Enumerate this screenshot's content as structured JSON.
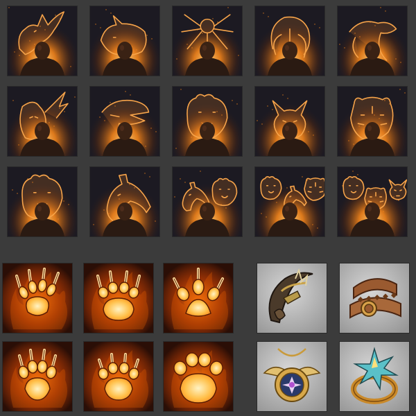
{
  "colors": {
    "background": "#3b3b3b",
    "spirit_bg": "#1c1a22",
    "glow": "#ff8a1a",
    "glow_light": "#ffd07a",
    "line": "#f7a44a",
    "figure": "#2a1a12",
    "item_bg": "#c9c9c9"
  },
  "spirit_icons": [
    {
      "name": "griffin",
      "creatures": [
        "griffin"
      ]
    },
    {
      "name": "rhino",
      "creatures": [
        "rhino"
      ]
    },
    {
      "name": "spider",
      "creatures": [
        "spider"
      ]
    },
    {
      "name": "mammoth",
      "creatures": [
        "mammoth"
      ]
    },
    {
      "name": "lizard",
      "creatures": [
        "lizard"
      ]
    },
    {
      "name": "dragon",
      "creatures": [
        "dragon"
      ]
    },
    {
      "name": "raptor",
      "creatures": [
        "raptor"
      ]
    },
    {
      "name": "bear-prowl",
      "creatures": [
        "bear"
      ]
    },
    {
      "name": "wolf",
      "creatures": [
        "wolf"
      ]
    },
    {
      "name": "tiger",
      "creatures": [
        "tiger"
      ]
    },
    {
      "name": "bear-roar",
      "creatures": [
        "bear"
      ]
    },
    {
      "name": "horse",
      "creatures": [
        "horse"
      ]
    },
    {
      "name": "horse-and-bear",
      "creatures": [
        "horse",
        "bear"
      ]
    },
    {
      "name": "bear-horse-tiger",
      "creatures": [
        "bear",
        "horse",
        "tiger"
      ]
    },
    {
      "name": "bear-tiger-wolf",
      "creatures": [
        "bear",
        "tiger",
        "wolf"
      ]
    }
  ],
  "paw_icons": [
    {
      "name": "claw-print",
      "claws": 4,
      "style": "raptor"
    },
    {
      "name": "bear-claw-print",
      "claws": 4,
      "style": "bear"
    },
    {
      "name": "three-toe-print",
      "claws": 3,
      "style": "three-toe"
    },
    {
      "name": "dog-claw-print",
      "claws": 4,
      "style": "canine"
    },
    {
      "name": "cat-claw-print",
      "claws": 4,
      "style": "feline"
    },
    {
      "name": "round-paw-print",
      "claws": 0,
      "style": "round"
    }
  ],
  "item_icons": [
    {
      "name": "bone-claw-bracer"
    },
    {
      "name": "leather-belt"
    },
    {
      "name": "winged-amulet"
    },
    {
      "name": "star-ring"
    }
  ]
}
